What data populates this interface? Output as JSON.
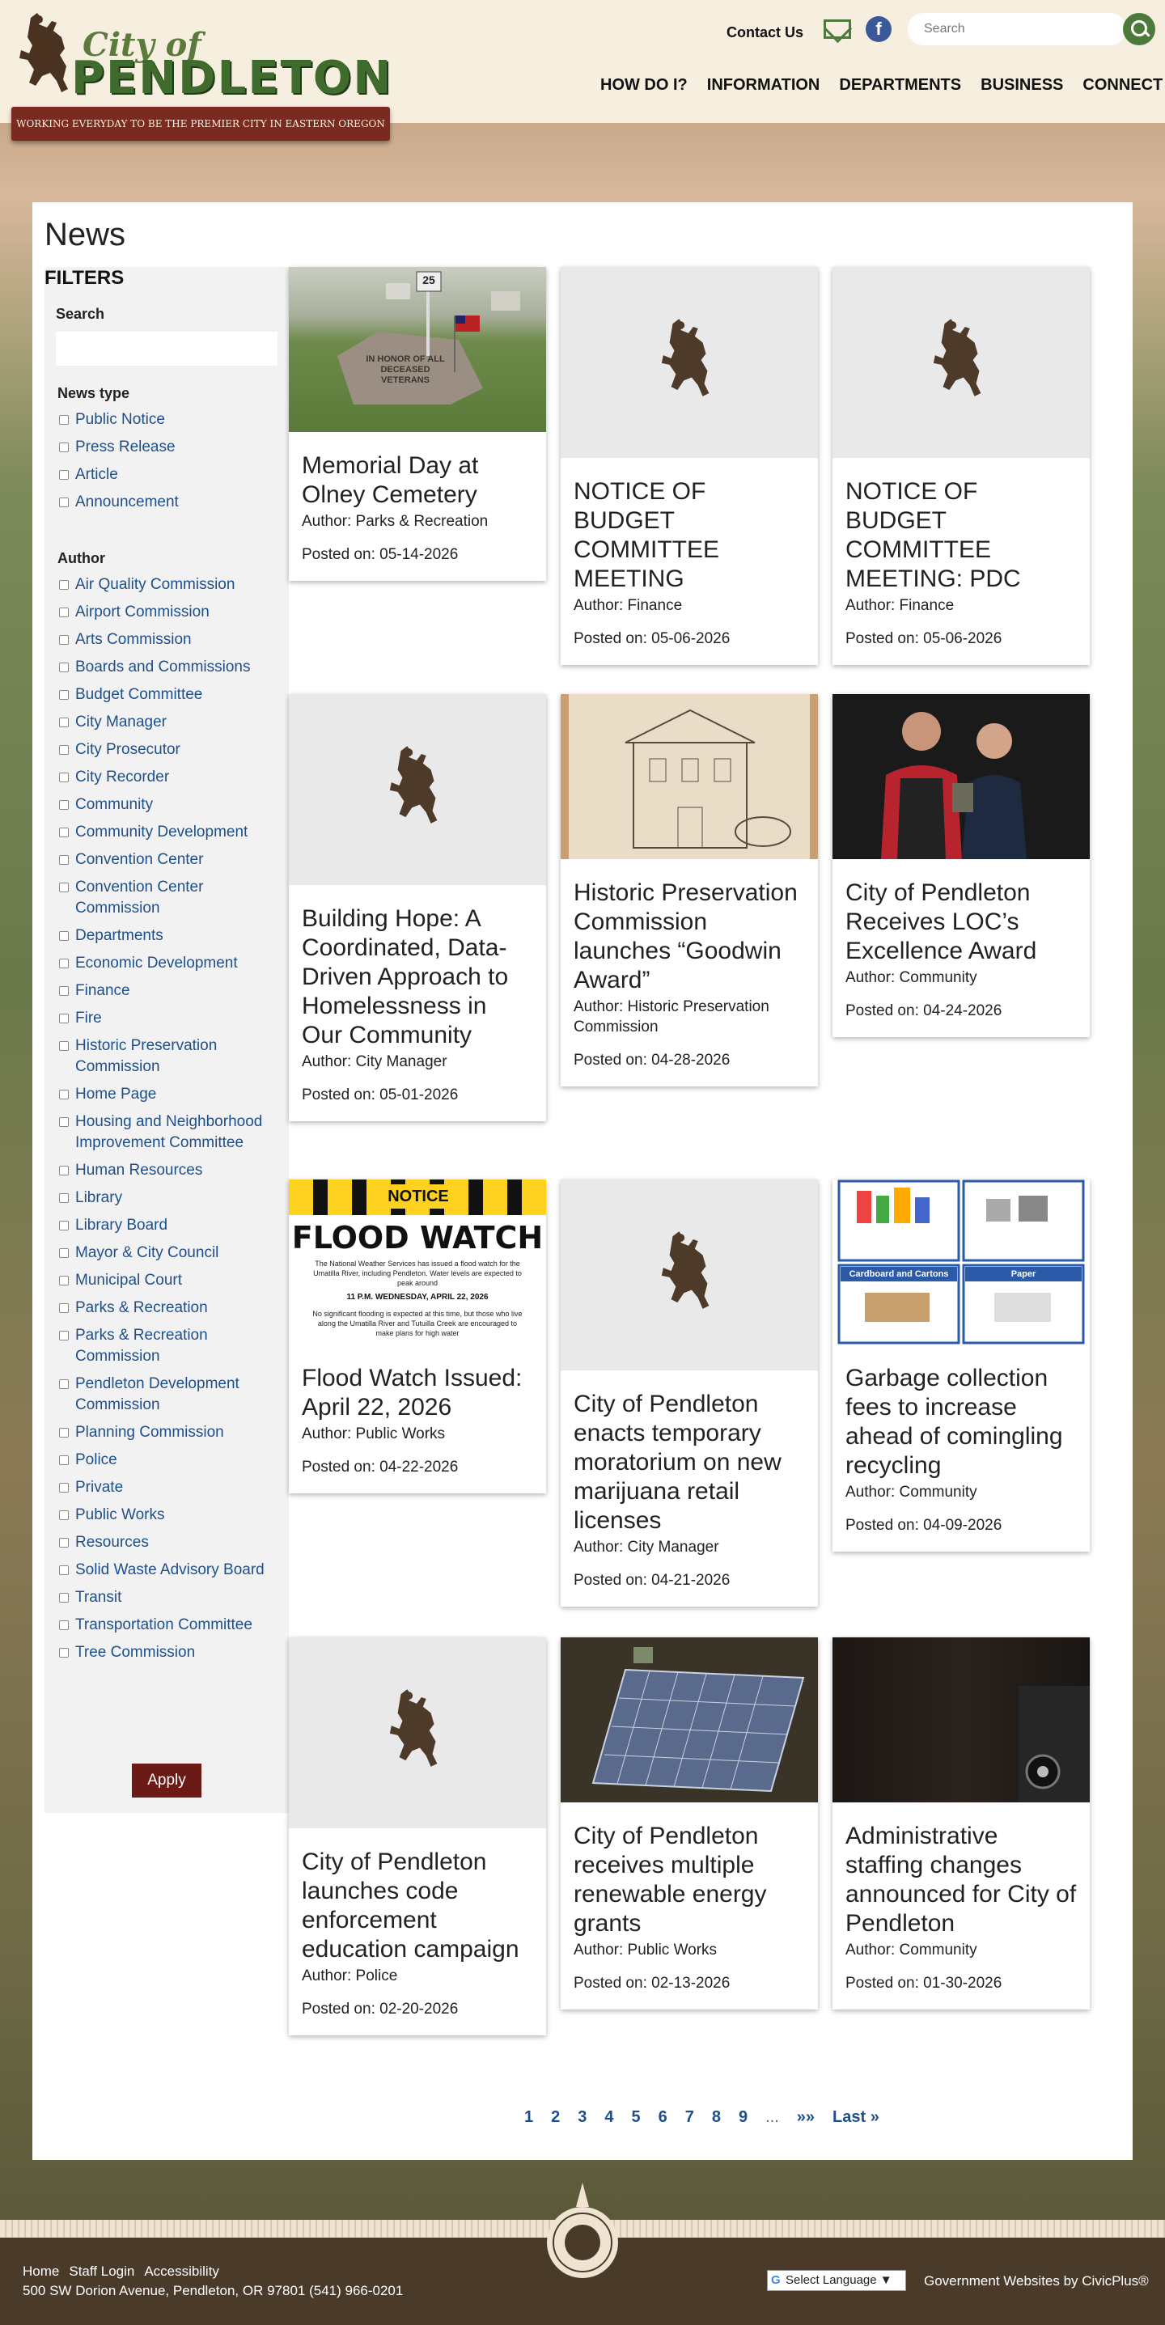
{
  "header": {
    "logo": {
      "city": "City of",
      "name": "PENDLETON"
    },
    "tagline": "WORKING EVERYDAY TO BE THE PREMIER CITY IN EASTERN OREGON",
    "contact_label": "Contact Us",
    "search_placeholder": "Search",
    "nav": [
      "HOW DO I?",
      "INFORMATION",
      "DEPARTMENTS",
      "BUSINESS",
      "CONNECT"
    ]
  },
  "page": {
    "title": "News"
  },
  "filters": {
    "title": "FILTERS",
    "search_label": "Search",
    "news_type_title": "News type",
    "news_types": [
      "Public Notice",
      "Press Release",
      "Article",
      "Announcement"
    ],
    "author_title": "Author",
    "authors": [
      "Air Quality Commission",
      "Airport Commission",
      "Arts Commission",
      "Boards and Commissions",
      "Budget Committee",
      "City Manager",
      "City Prosecutor",
      "City Recorder",
      "Community",
      "Community Development",
      "Convention Center",
      "Convention Center Commission",
      "Departments",
      "Economic Development",
      "Finance",
      "Fire",
      "Historic Preservation Commission",
      "Home Page",
      "Housing and Neighborhood Improvement Committee",
      "Human Resources",
      "Library",
      "Library Board",
      "Mayor & City Council",
      "Municipal Court",
      "Parks & Recreation",
      "Parks & Recreation Commission",
      "Pendleton Development Commission",
      "Planning Commission",
      "Police",
      "Private",
      "Public Works",
      "Resources",
      "Solid Waste Advisory Board",
      "Transit",
      "Transportation Committee",
      "Tree Commission"
    ],
    "apply_label": "Apply"
  },
  "cards": [
    {
      "title": "Memorial Day at Olney Cemetery",
      "author": "Author: Parks & Recreation",
      "date": "Posted on: 05-14-2026",
      "image": "cemetery"
    },
    {
      "title": "NOTICE OF BUDGET COMMITTEE MEETING",
      "author": "Author: Finance",
      "date": "Posted on: 05-06-2026",
      "image": "placeholder"
    },
    {
      "title": "NOTICE OF BUDGET COMMITTEE MEETING: PDC",
      "author": "Author: Finance",
      "date": "Posted on: 05-06-2026",
      "image": "placeholder"
    },
    {
      "title": "Building Hope: A Coordinated, Data-Driven Approach to Homelessness in Our Community",
      "author": "Author: City Manager",
      "date": "Posted on: 05-01-2026",
      "image": "placeholder"
    },
    {
      "title": "Historic Preservation Commission launches “Goodwin Award”",
      "author": "Author: Historic Preservation Commission",
      "date": "Posted on: 04-28-2026",
      "image": "house"
    },
    {
      "title": "City of Pendleton Receives LOC’s Excellence Award",
      "author": "Author: Community",
      "date": "Posted on: 04-24-2026",
      "image": "award"
    },
    {
      "title": "Flood Watch Issued: April 22, 2026",
      "author": "Author: Public Works",
      "date": "Posted on: 04-22-2026",
      "image": "flood"
    },
    {
      "title": "City of Pendleton enacts temporary moratorium on new marijuana retail licenses",
      "author": "Author: City Manager",
      "date": "Posted on: 04-21-2026",
      "image": "placeholder"
    },
    {
      "title": "Garbage collection fees to increase ahead of comingling recycling",
      "author": "Author: Community",
      "date": "Posted on: 04-09-2026",
      "image": "recycling"
    },
    {
      "title": "City of Pendleton launches code enforcement education campaign",
      "author": "Author: Police",
      "date": "Posted on: 02-20-2026",
      "image": "placeholder"
    },
    {
      "title": "City of Pendleton receives multiple renewable energy grants",
      "author": "Author: Public Works",
      "date": "Posted on: 02-13-2026",
      "image": "solar"
    },
    {
      "title": "Administrative staffing changes announced for City of Pendleton",
      "author": "Author: Community",
      "date": "Posted on: 01-30-2026",
      "image": "dark"
    }
  ],
  "flood_notice": {
    "banner": "NOTICE",
    "headline": "FLOOD WATCH",
    "body": "The National Weather Services has issued a flood watch for the Umatilla River, including Pendleton. Water levels are expected to peak around",
    "time": "11 P.M. WEDNESDAY, APRIL 22, 2026",
    "body2": "No significant flooding is expected at this time, but those who live along the Umatilla River and Tutuilla Creek are encouraged to make plans for high water"
  },
  "recycling": {
    "tile3": "Cardboard and Cartons",
    "tile4": "Paper"
  },
  "cemetery": {
    "plaque": "IN HONOR OF ALL DECEASED VETERANS",
    "sign": "25"
  },
  "pagination": {
    "pages": [
      "1",
      "2",
      "3",
      "4",
      "5",
      "6",
      "7",
      "8",
      "9"
    ],
    "ellipsis": "...",
    "next": "»»",
    "last": "Last »"
  },
  "footer": {
    "links": [
      "Home",
      "Staff Login",
      "Accessibility"
    ],
    "address": "500 SW Dorion Avenue, Pendleton, OR 97801 (541) 966-0201",
    "language": "Select Language ▼",
    "vendor": "Government Websites by CivicPlus®"
  },
  "colors": {
    "accent": "#4c7a3a",
    "brand_red": "#7a2a1e",
    "link": "#1f4f8a",
    "apply": "#6b1a15"
  }
}
